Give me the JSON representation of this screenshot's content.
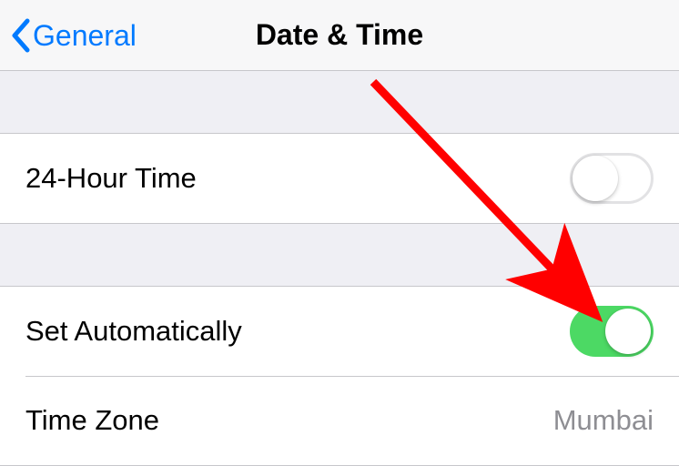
{
  "navbar": {
    "back_label": "General",
    "title": "Date & Time"
  },
  "rows": {
    "twenty_four_hour_label": "24-Hour Time",
    "set_automatically_label": "Set Automatically",
    "time_zone_label": "Time Zone",
    "time_zone_value": "Mumbai"
  },
  "toggles": {
    "twenty_four_hour_on": false,
    "set_automatically_on": true
  },
  "colors": {
    "accent": "#007aff",
    "toggle_on": "#4cd964",
    "annotation": "#ff0000"
  }
}
